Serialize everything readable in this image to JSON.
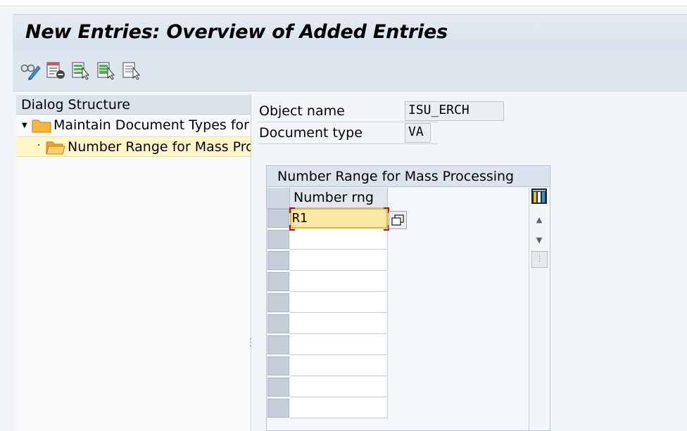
{
  "screen": {
    "title": "New Entries: Overview of Added Entries"
  },
  "toolbar": {
    "buttons": [
      "display-change-icon",
      "delete-row-icon",
      "select-all-icon",
      "select-block-icon",
      "deselect-all-icon"
    ]
  },
  "dialog_structure": {
    "header": "Dialog Structure",
    "items": [
      {
        "label": "Maintain Document Types for B",
        "expanded": true,
        "selected": false
      },
      {
        "label": "Number Range for Mass Proce",
        "expanded": false,
        "selected": true
      }
    ]
  },
  "fields": {
    "object_name": {
      "label": "Object name",
      "value": "ISU_ERCH"
    },
    "document_type": {
      "label": "Document type",
      "value": "VA"
    }
  },
  "table": {
    "title": "Number Range for Mass Processing",
    "columns": [
      "Number rng"
    ],
    "rows": [
      "R1",
      "",
      "",
      "",
      "",
      "",
      "",
      "",
      "",
      ""
    ]
  },
  "colors": {
    "selected_tree_row": "#fff7c7",
    "active_cell": "#fde8a4",
    "folder": "#f6b63a"
  }
}
